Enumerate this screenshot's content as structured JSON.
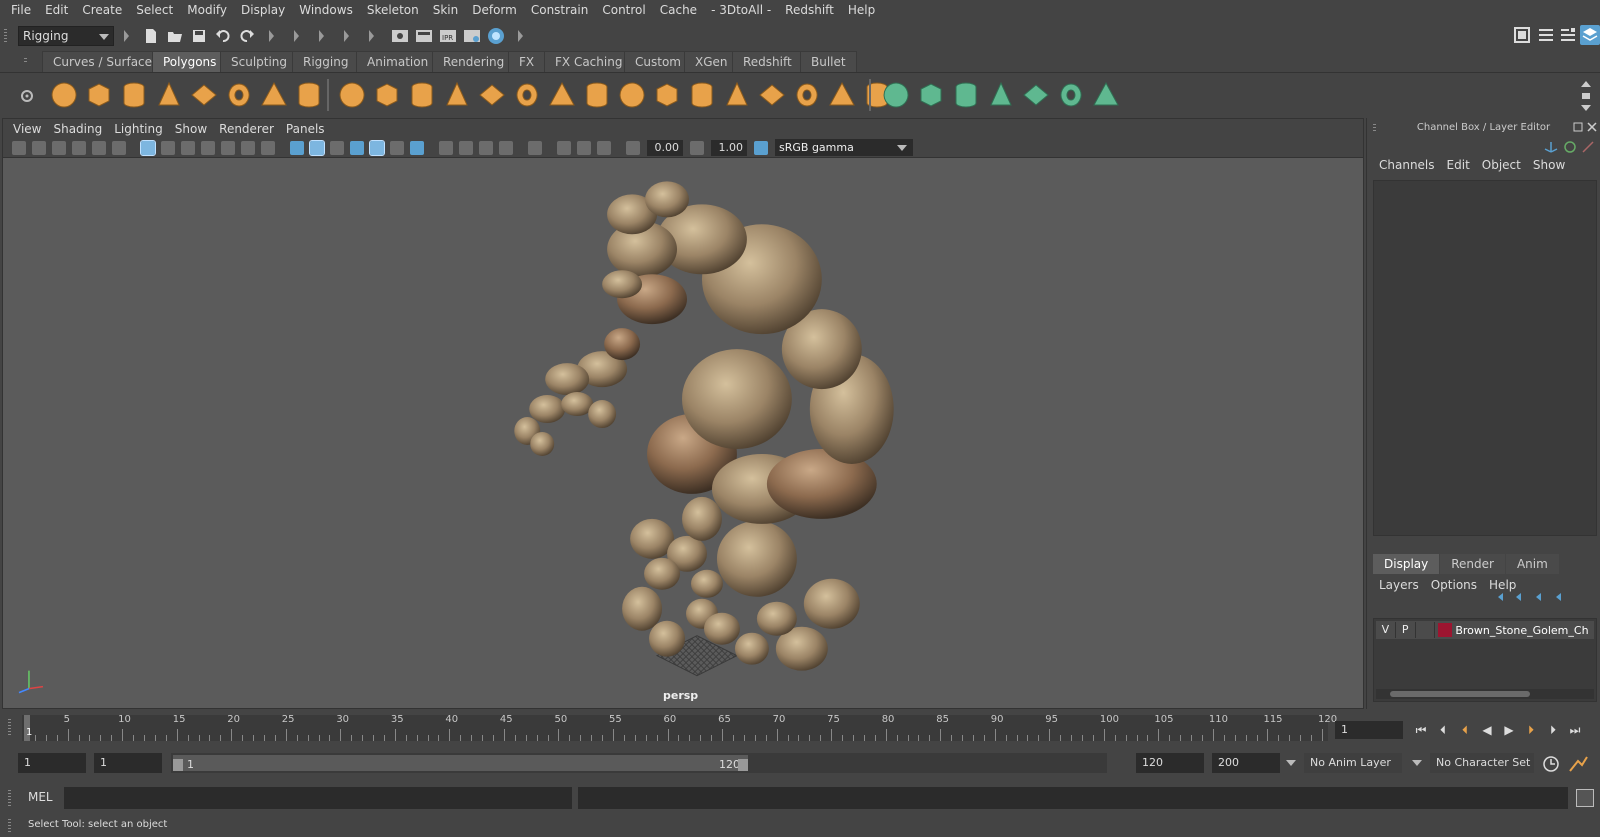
{
  "menubar": {
    "items": [
      "File",
      "Edit",
      "Create",
      "Select",
      "Modify",
      "Display",
      "Windows",
      "Skeleton",
      "Skin",
      "Deform",
      "Constrain",
      "Control",
      "Cache",
      "- 3DtoAll -",
      "Redshift",
      "Help"
    ]
  },
  "statusline": {
    "menuset": "Rigging"
  },
  "shelf": {
    "tabs": [
      "Curves / Surfaces",
      "Polygons",
      "Sculpting",
      "Rigging",
      "Animation",
      "Rendering",
      "FX",
      "FX Caching",
      "Custom",
      "XGen",
      "Redshift",
      "Bullet"
    ],
    "active_tab": "Polygons",
    "icons": [
      "sphere-icon",
      "cube-icon",
      "cylinder-icon",
      "cone-icon",
      "plane-icon",
      "torus-icon",
      "pyramid-icon",
      "pipe-icon",
      "combine-icon",
      "separate-icon",
      "extract-icon",
      "smooth-icon",
      "boolean-icon",
      "average-icon",
      "multicut-icon",
      "target-weld-icon",
      "bridge-icon",
      "append-icon",
      "extrude-icon",
      "bevel-icon",
      "fill-hole-icon",
      "mirror-icon",
      "merge-icon",
      "wedge-icon",
      "uv-planar-icon",
      "uv-cylindrical-icon",
      "uv-spherical-icon",
      "uv-automatic-icon",
      "uv-unfold-icon",
      "uv-editor-icon",
      "uv-layout-icon"
    ]
  },
  "viewport": {
    "menus": [
      "View",
      "Shading",
      "Lighting",
      "Show",
      "Renderer",
      "Panels"
    ],
    "exposure": "0.00",
    "gamma": "1.00",
    "color_space": "sRGB gamma",
    "camera_label": "persp"
  },
  "right_panel": {
    "title": "Channel Box / Layer Editor",
    "menus": [
      "Channels",
      "Edit",
      "Object",
      "Show"
    ],
    "layer_tabs": [
      "Display",
      "Render",
      "Anim"
    ],
    "active_layer_tab": "Display",
    "layer_menus": [
      "Layers",
      "Options",
      "Help"
    ],
    "layer": {
      "visible": "V",
      "playback": "P",
      "name": "Brown_Stone_Golem_Ch",
      "color": "#9c1530"
    }
  },
  "timeline": {
    "ticks": [
      "5",
      "10",
      "15",
      "20",
      "25",
      "30",
      "35",
      "40",
      "45",
      "50",
      "55",
      "60",
      "65",
      "70",
      "75",
      "80",
      "85",
      "90",
      "95",
      "100",
      "105",
      "110",
      "115",
      "120"
    ],
    "current_frame_marker": "1",
    "current_frame": "1"
  },
  "range": {
    "start": "1",
    "playback_start": "1",
    "slider_low": "1",
    "slider_high": "120",
    "playback_end": "120",
    "end": "200",
    "anim_layer": "No Anim Layer",
    "character_set": "No Character Set"
  },
  "command_line": {
    "label": "MEL"
  },
  "help_line": {
    "text": "Select Tool: select an object"
  },
  "colors": {
    "accent_blue": "#5aa0d0",
    "shelf_orange": "#e8a24a",
    "shelf_green": "#5fb890",
    "golem_stone": "#9b8466"
  }
}
